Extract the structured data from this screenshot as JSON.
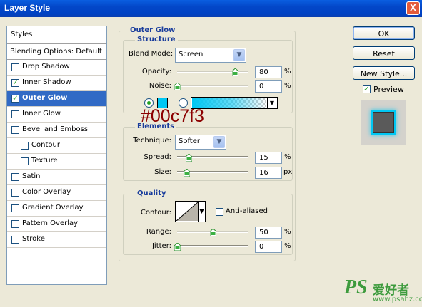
{
  "window": {
    "title": "Layer Style",
    "close_label": "X"
  },
  "sidebar": {
    "header": "Styles",
    "blending": "Blending Options: Default",
    "items": [
      {
        "label": "Drop Shadow",
        "checked": false
      },
      {
        "label": "Inner Shadow",
        "checked": true
      },
      {
        "label": "Outer Glow",
        "checked": true
      },
      {
        "label": "Inner Glow",
        "checked": false
      },
      {
        "label": "Bevel and Emboss",
        "checked": false
      },
      {
        "label": "Contour",
        "checked": false
      },
      {
        "label": "Texture",
        "checked": false
      },
      {
        "label": "Satin",
        "checked": false
      },
      {
        "label": "Color Overlay",
        "checked": false
      },
      {
        "label": "Gradient Overlay",
        "checked": false
      },
      {
        "label": "Pattern Overlay",
        "checked": false
      },
      {
        "label": "Stroke",
        "checked": false
      }
    ]
  },
  "outer_glow": {
    "title": "Outer Glow",
    "structure": {
      "title": "Structure",
      "blend_mode_label": "Blend Mode:",
      "blend_mode": "Screen",
      "opacity_label": "Opacity:",
      "opacity": "80",
      "opacity_unit": "%",
      "noise_label": "Noise:",
      "noise": "0",
      "noise_unit": "%",
      "color": "#00c7f3",
      "color_annotation": "#00c7f3"
    },
    "elements": {
      "title": "Elements",
      "technique_label": "Technique:",
      "technique": "Softer",
      "spread_label": "Spread:",
      "spread": "15",
      "spread_unit": "%",
      "size_label": "Size:",
      "size": "16",
      "size_unit": "px"
    },
    "quality": {
      "title": "Quality",
      "contour_label": "Contour:",
      "anti_aliased_label": "Anti-aliased",
      "range_label": "Range:",
      "range": "50",
      "range_unit": "%",
      "jitter_label": "Jitter:",
      "jitter": "0",
      "jitter_unit": "%"
    }
  },
  "buttons": {
    "ok": "OK",
    "reset": "Reset",
    "new_style": "New Style...",
    "preview": "Preview"
  },
  "watermark": {
    "logo": "PS",
    "cn": "爱好者",
    "url": "www.psahz.com"
  }
}
